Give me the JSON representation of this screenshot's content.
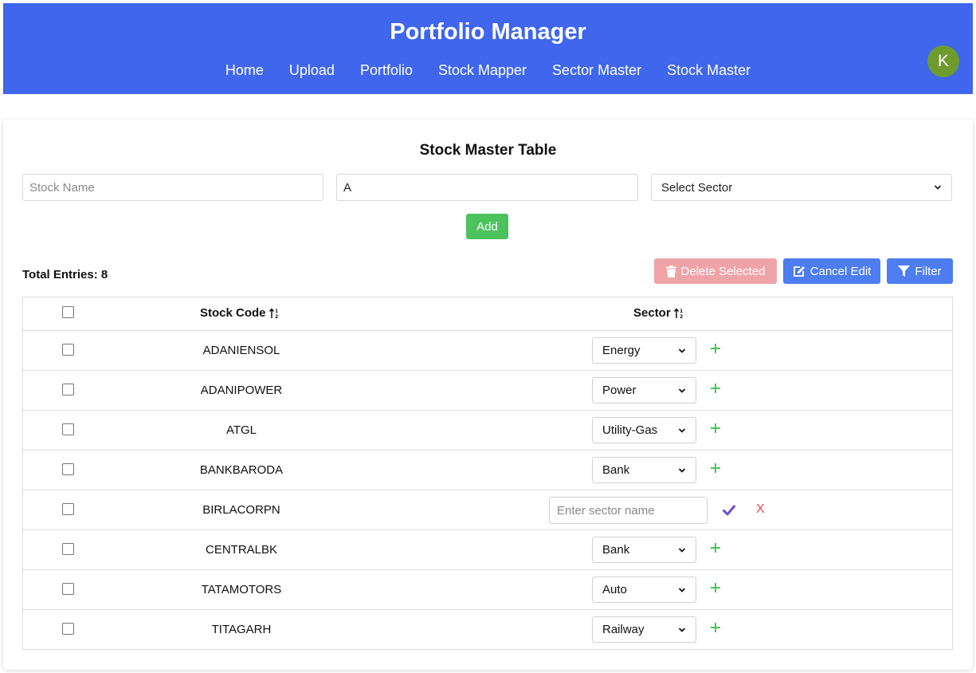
{
  "header": {
    "title": "Portfolio Manager",
    "nav": [
      "Home",
      "Upload",
      "Portfolio",
      "Stock Mapper",
      "Sector Master",
      "Stock Master"
    ],
    "avatar_initial": "K"
  },
  "form": {
    "title": "Stock Master Table",
    "stock_name_placeholder": "Stock Name",
    "code_value": "A",
    "sector_placeholder": "Select Sector",
    "add_label": "Add"
  },
  "toolbar": {
    "total_label": "Total Entries: 8",
    "delete_label": "Delete Selected",
    "cancel_label": "Cancel Edit",
    "filter_label": "Filter"
  },
  "table": {
    "col_code": "Stock Code",
    "col_sector": "Sector",
    "rows": [
      {
        "code": "ADANIENSOL",
        "sector": "Energy"
      },
      {
        "code": "ADANIPOWER",
        "sector": "Power"
      },
      {
        "code": "ATGL",
        "sector": "Utility-Gas"
      },
      {
        "code": "BANKBARODA",
        "sector": "Bank"
      },
      {
        "code": "BIRLACORPN",
        "editing": true,
        "input_placeholder": "Enter sector name"
      },
      {
        "code": "CENTRALBK",
        "sector": "Bank"
      },
      {
        "code": "TATAMOTORS",
        "sector": "Auto"
      },
      {
        "code": "TITAGARH",
        "sector": "Railway"
      }
    ],
    "cancel_symbol": "X"
  },
  "colors": {
    "header_bg": "#4066ee",
    "accent_blue": "#4d7df0",
    "add_green": "#4cc25c",
    "delete_disabled": "#f0a3a7",
    "avatar_bg": "#6e9b2e"
  }
}
